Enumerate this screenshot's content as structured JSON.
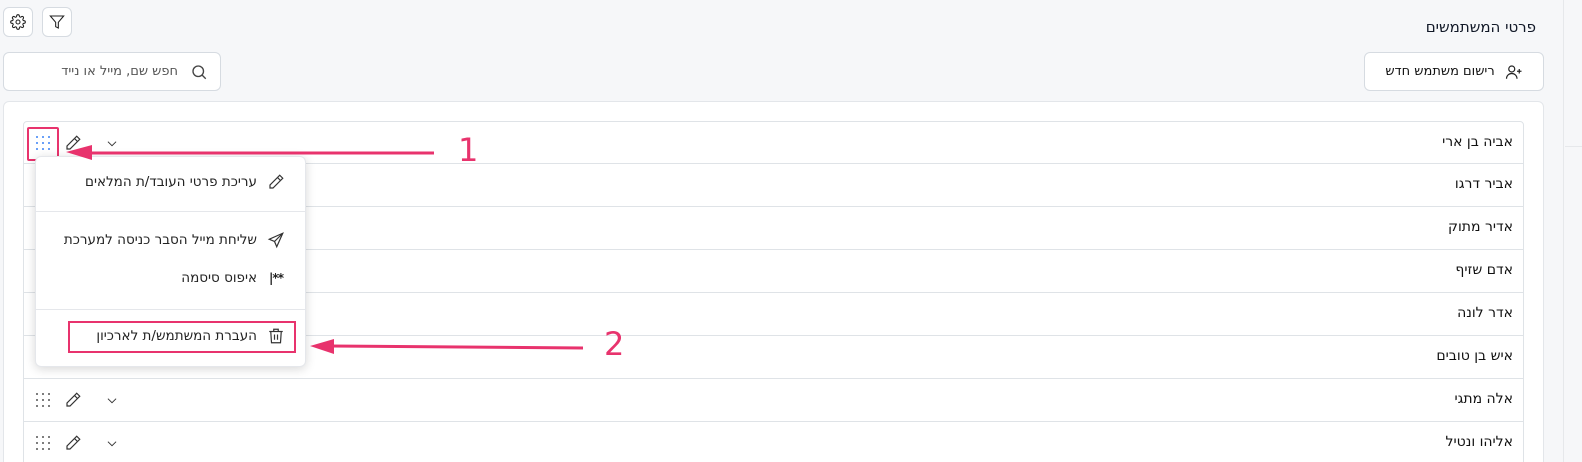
{
  "page": {
    "title": "פרטי המשתמשים"
  },
  "toolbar": {
    "new_user_label": "רישום משתמש חדש",
    "search_placeholder": "חפש שם, מייל או נייד",
    "search_value": ""
  },
  "users": [
    {
      "name": "אביה בן ארי"
    },
    {
      "name": "אביר דרגו"
    },
    {
      "name": "אדיר מתוק"
    },
    {
      "name": "אדם שזיף"
    },
    {
      "name": "אדר לונה"
    },
    {
      "name": "איש בן טובים"
    },
    {
      "name": "אלה מתגי"
    },
    {
      "name": "אליהו ונטיל"
    }
  ],
  "context_menu": {
    "edit_details": "עריכת פרטי העובד/ת המלאים",
    "send_login_email": "שליחת מייל הסבר כניסה למערכת",
    "reset_password": "איפוס סיסמה",
    "reset_password_icon_text": "**|",
    "archive_user": "העברת המשתמש/ת לארכיון"
  },
  "annotations": {
    "first": "1",
    "second": "2"
  },
  "colors": {
    "annotation": "#e8336d",
    "grip_active": "#3b82f6"
  }
}
